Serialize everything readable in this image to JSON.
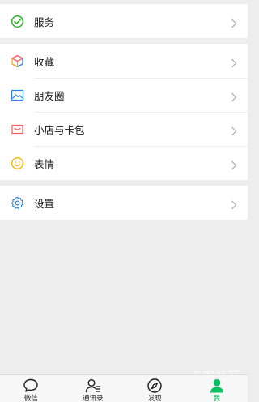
{
  "menu": {
    "group1": [
      {
        "label": "服务",
        "icon": "service-wallet-icon"
      }
    ],
    "group2": [
      {
        "label": "收藏",
        "icon": "favorites-cube-icon"
      },
      {
        "label": "朋友圈",
        "icon": "moments-image-icon"
      },
      {
        "label": "小店与卡包",
        "icon": "shop-card-icon"
      },
      {
        "label": "表情",
        "icon": "emoji-smile-icon"
      }
    ],
    "group3": [
      {
        "label": "设置",
        "icon": "settings-gear-icon"
      }
    ]
  },
  "tabbar": {
    "tabs": [
      {
        "label": "微信",
        "icon": "chat-bubble-icon"
      },
      {
        "label": "通讯录",
        "icon": "contacts-icon"
      },
      {
        "label": "发现",
        "icon": "compass-icon"
      },
      {
        "label": "我",
        "icon": "person-icon"
      }
    ],
    "active_index": 3
  },
  "watermark": "卡农社区",
  "colors": {
    "accent_green": "#07c160",
    "background": "#ededed",
    "service_icon": "#1aad19",
    "favorites_icon": "#f6a623",
    "moments_icon": "#2b82e8",
    "shop_icon": "#f25f5c",
    "emoji_icon": "#f7b500",
    "settings_icon": "#2a7fe1"
  }
}
